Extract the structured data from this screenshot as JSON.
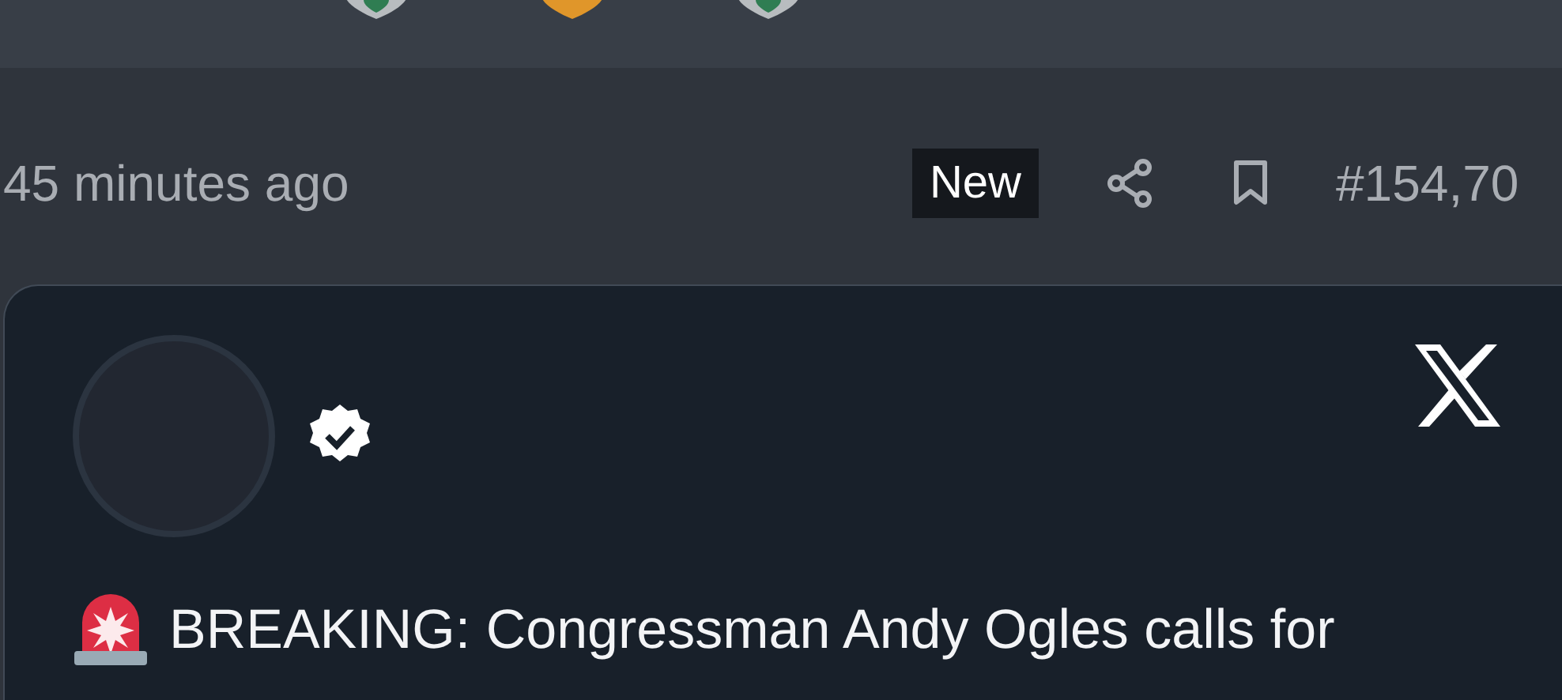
{
  "post": {
    "time": "45 minutes ago",
    "badge": "New",
    "number": "#154,70"
  },
  "tweet": {
    "verified": true,
    "text": "BREAKING: Congressman Andy Ogles calls for"
  }
}
